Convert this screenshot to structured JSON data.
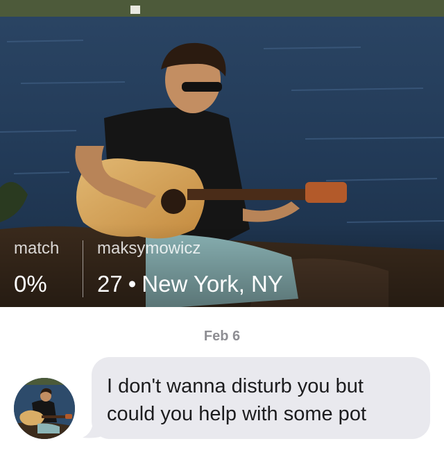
{
  "profile": {
    "photo_icon": "profile-photo",
    "match_label": "match",
    "match_value": "0%",
    "username": "maksymowicz",
    "age": "27",
    "separator": "•",
    "location": "New York, NY"
  },
  "conversation": {
    "date": "Feb 6",
    "messages": [
      {
        "avatar_icon": "user-avatar",
        "text": "I don't wanna disturb you but could you help with some pot"
      }
    ]
  },
  "colors": {
    "bubble_bg": "#e9e9ee",
    "date_text": "#8e8e93",
    "overlay_text": "#ffffff"
  }
}
